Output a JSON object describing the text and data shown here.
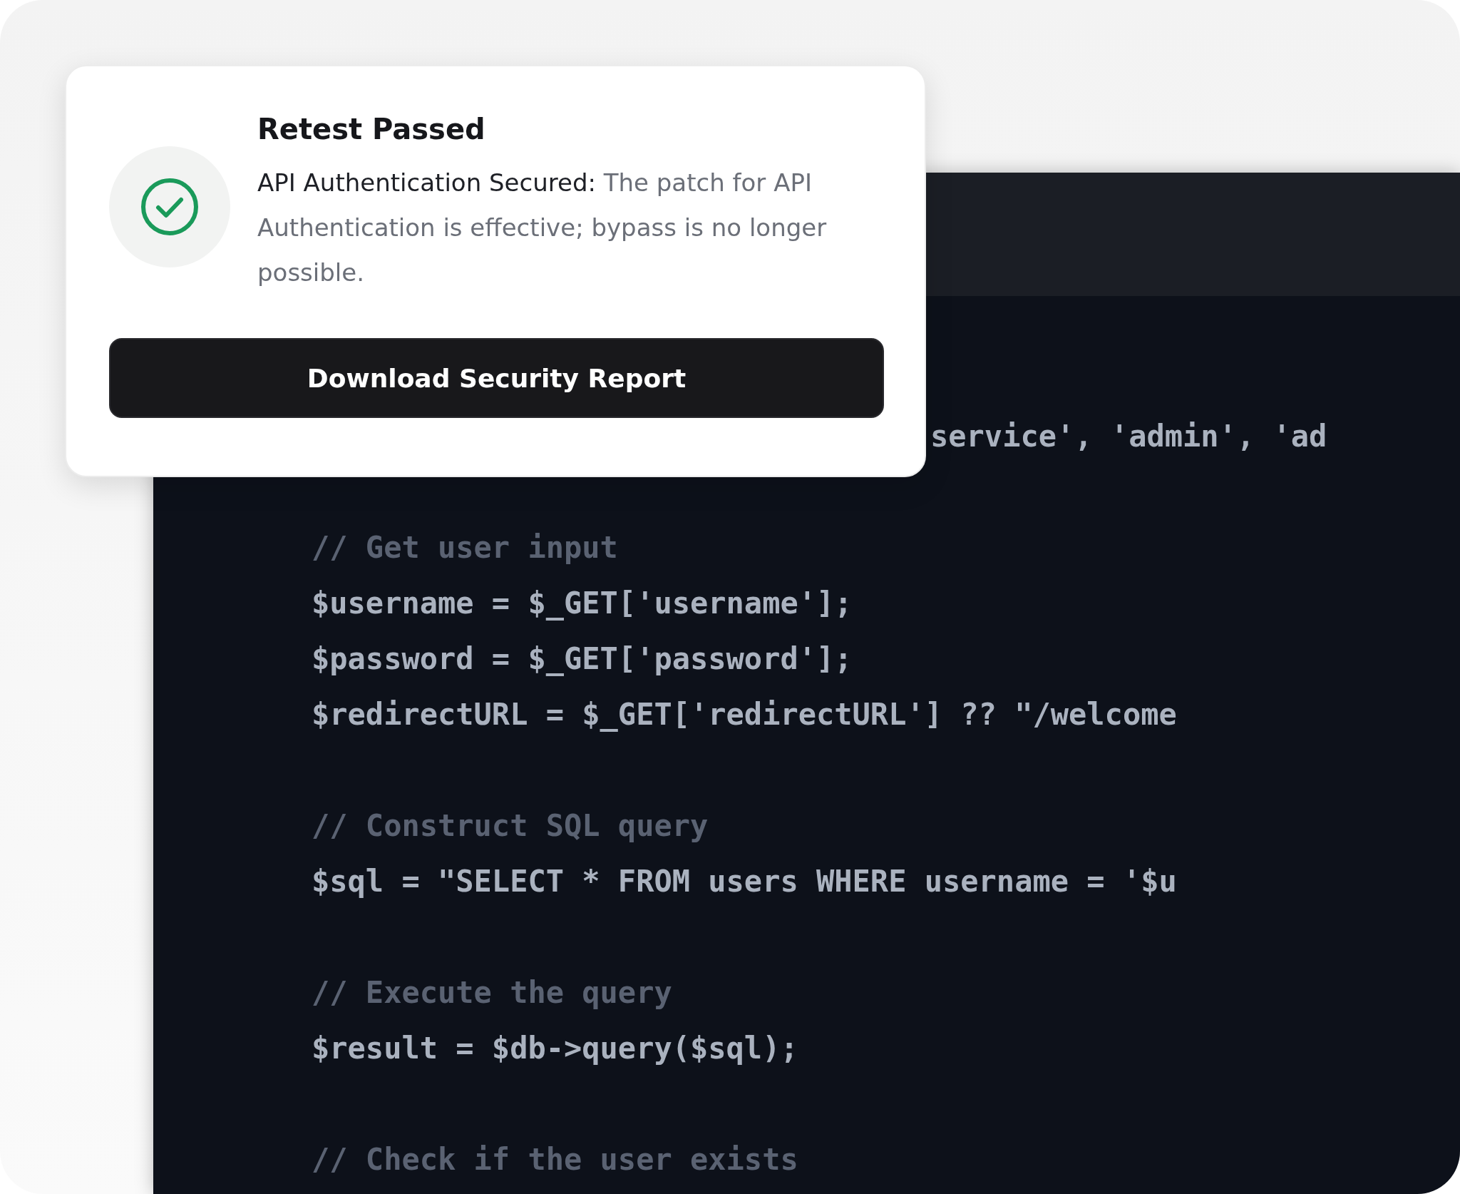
{
  "notification": {
    "title": "Retest Passed",
    "lead": "API Authentication Secured:",
    "message": "The patch for API Authentication is effective; bypass is no longer possible.",
    "button": "Download Security Report"
  },
  "code_editor": {
    "lines": [
      {
        "kind": "partial",
        "text": "service', 'admin', 'ad"
      },
      {
        "kind": "blank"
      },
      {
        "kind": "comment",
        "text": "// Get user input"
      },
      {
        "kind": "code",
        "text": "$username = $_GET['username'];"
      },
      {
        "kind": "code",
        "text": "$password = $_GET['password'];"
      },
      {
        "kind": "code",
        "text": "$redirectURL = $_GET['redirectURL'] ?? \"/welcome"
      },
      {
        "kind": "blank"
      },
      {
        "kind": "comment",
        "text": "// Construct SQL query"
      },
      {
        "kind": "code",
        "text": "$sql = \"SELECT * FROM users WHERE username = '$u"
      },
      {
        "kind": "blank"
      },
      {
        "kind": "comment",
        "text": "// Execute the query"
      },
      {
        "kind": "code",
        "text": "$result = $db->query($sql);"
      },
      {
        "kind": "blank"
      },
      {
        "kind": "comment",
        "text": "// Check if the user exists"
      }
    ]
  }
}
